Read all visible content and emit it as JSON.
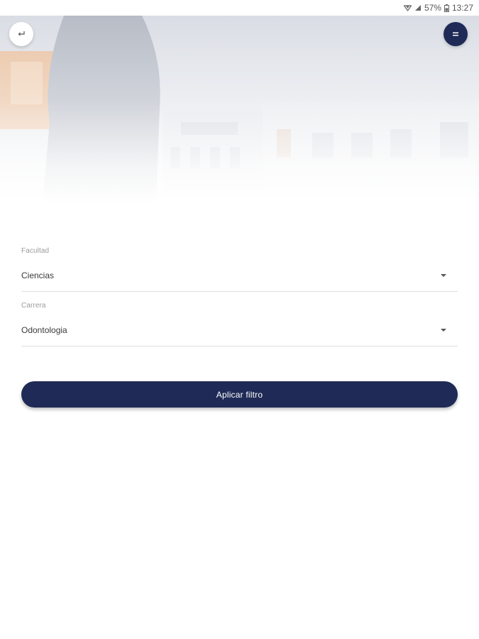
{
  "status_bar": {
    "battery": "57%",
    "time": "13:27",
    "icons": [
      "wifi-icon",
      "signal-icon",
      "battery-icon"
    ]
  },
  "header": {
    "back_icon": "back-arrow-icon",
    "menu_icon": "menu-icon"
  },
  "filters": [
    {
      "label": "Facultad",
      "value": "Ciencias"
    },
    {
      "label": "Carrera",
      "value": "Odontologia"
    }
  ],
  "apply_button": {
    "label": "Aplicar filtro"
  },
  "colors": {
    "primary": "#1f2b56",
    "label": "#9b9b9b",
    "text": "#3a3a3a"
  }
}
